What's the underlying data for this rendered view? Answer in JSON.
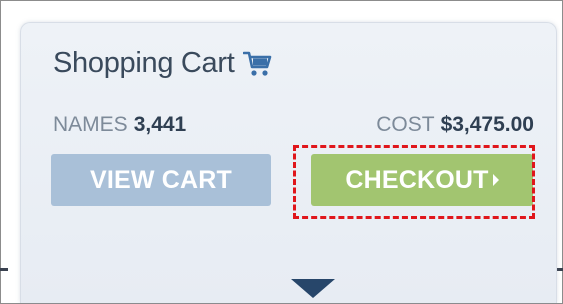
{
  "cart": {
    "title": "Shopping Cart",
    "names_label": "NAMES",
    "names_value": "3,441",
    "cost_label": "COST",
    "cost_value": "$3,475.00",
    "view_cart_label": "VIEW CART",
    "checkout_label": "CHECKOUT"
  },
  "colors": {
    "title_text": "#3a4a5c",
    "view_cart_bg": "#a9c0d8",
    "checkout_bg": "#a2c570",
    "highlight_border": "#e0161b",
    "arrow": "#27466a"
  },
  "icons": {
    "cart": "shopping-cart-icon",
    "checkout_caret": "chevron-right-icon",
    "expand": "chevron-down-icon"
  }
}
